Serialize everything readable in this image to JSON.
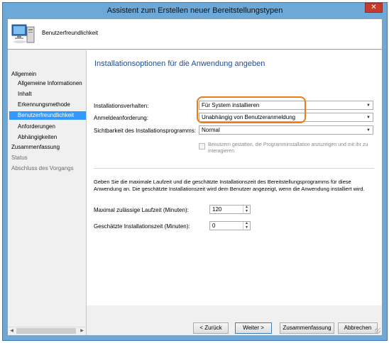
{
  "window": {
    "title": "Assistent zum Erstellen neuer Bereitstellungstypen",
    "close_glyph": "✕"
  },
  "banner": {
    "title": "Benutzerfreundlichkeit",
    "icon": "computer-icon"
  },
  "nav": {
    "items": [
      {
        "label": "Allgemein",
        "level": 0,
        "state": "normal"
      },
      {
        "label": "Allgemeine Informationen",
        "level": 1,
        "state": "normal"
      },
      {
        "label": "Inhalt",
        "level": 1,
        "state": "normal"
      },
      {
        "label": "Erkennungsmethode",
        "level": 1,
        "state": "normal"
      },
      {
        "label": "Benutzerfreundlichkeit",
        "level": 1,
        "state": "active"
      },
      {
        "label": "Anforderungen",
        "level": 1,
        "state": "normal"
      },
      {
        "label": "Abhängigkeiten",
        "level": 1,
        "state": "normal"
      },
      {
        "label": "Zusammenfassung",
        "level": 0,
        "state": "normal"
      },
      {
        "label": "Status",
        "level": 0,
        "state": "dim"
      },
      {
        "label": "Abschluss des Vorgangs",
        "level": 0,
        "state": "dim"
      }
    ],
    "scroll_left": "◀",
    "scroll_right": "▶"
  },
  "page": {
    "heading": "Installationsoptionen für die Anwendung angeben",
    "install_behavior": {
      "label": "Installationsverhalten:",
      "value": "Für System installieren"
    },
    "logon_requirement": {
      "label": "Anmeldeanforderung:",
      "value": "Unabhängig von Benutzeranmeldung"
    },
    "visibility": {
      "label": "Sichtbarkeit des Installationsprogramms:",
      "value": "Normal"
    },
    "allow_interaction": {
      "label": "Benutzern gestatten, die Programminstallation anzuzeigen und mit ihr zu interagieren",
      "checked": false,
      "enabled": false
    },
    "description": "Geben Sie die maximale Laufzeit und die geschätzte Installationszeit des Bereitstellungsprogramms für diese Anwendung an. Die geschätzte Installationszeit wird dem Benutzer angezeigt, wenn die Anwendung installiert wird.",
    "max_runtime": {
      "label": "Maximal zulässige Laufzeit (Minuten):",
      "value": "120"
    },
    "est_install_time": {
      "label": "Geschätzte Installationszeit (Minuten):",
      "value": "0"
    },
    "dropdown_arrow": "▼",
    "spin_up": "▲",
    "spin_down": "▼",
    "highlight_color": "#f07a13"
  },
  "footer": {
    "back": "< Zurück",
    "next": "Weiter >",
    "summary": "Zusammenfassung",
    "cancel": "Abbrechen"
  },
  "colors": {
    "accent": "#3399ff",
    "heading": "#1e4b9a",
    "frame": "#6ca8d8",
    "close": "#c73b2f"
  }
}
